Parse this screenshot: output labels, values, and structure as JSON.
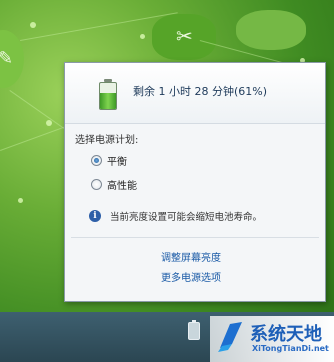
{
  "battery": {
    "remaining_text": "剩余 1 小时 28 分钟(61%)",
    "charge_fraction": 0.61,
    "icon": "battery-icon"
  },
  "power_plan": {
    "label": "选择电源计划:",
    "options": [
      {
        "label": "平衡",
        "selected": true
      },
      {
        "label": "高性能",
        "selected": false
      }
    ]
  },
  "info": {
    "icon": "info-icon",
    "text": "当前亮度设置可能会缩短电池寿命。"
  },
  "links": {
    "adjust_brightness": "调整屏幕亮度",
    "more_options": "更多电源选项"
  },
  "watermark": {
    "title": "系统天地",
    "subtitle": "XiTongTianDi.net"
  },
  "colors": {
    "link": "#1a5aa6",
    "desktop": "#5a9a2f",
    "taskbar": "#2b4652"
  }
}
